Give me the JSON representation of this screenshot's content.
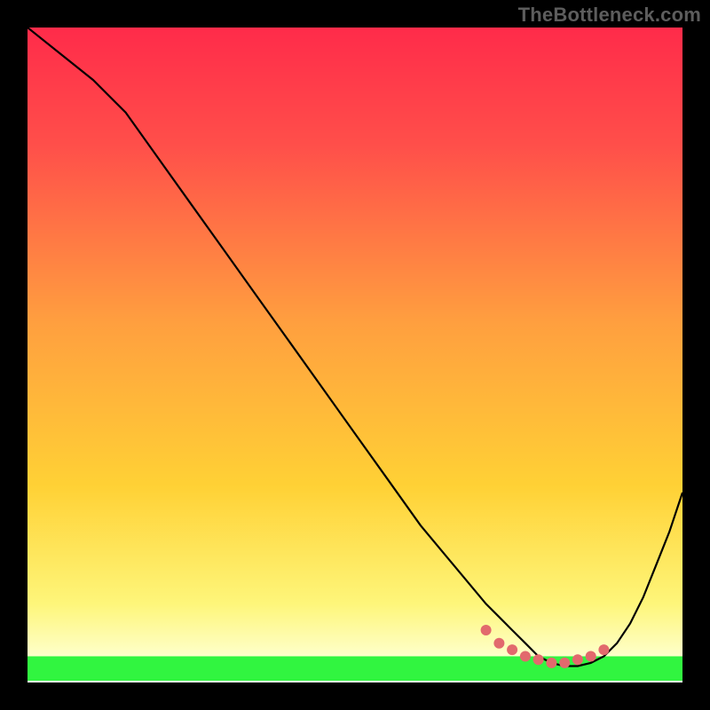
{
  "watermark": "TheBottleneck.com",
  "colors": {
    "curve": "#000000",
    "dots": "#e2696d",
    "green_band": "#31f540",
    "gradient_top": "#ff2b4a",
    "gradient_mid": "#ffd135",
    "gradient_low": "#fef67a",
    "gradient_bottom": "#ffffff"
  },
  "chart_data": {
    "type": "line",
    "title": "",
    "xlabel": "",
    "ylabel": "",
    "xlim": [
      0,
      100
    ],
    "ylim": [
      0,
      100
    ],
    "series": [
      {
        "name": "curve",
        "x": [
          0,
          5,
          10,
          15,
          20,
          25,
          30,
          35,
          40,
          45,
          50,
          55,
          60,
          65,
          70,
          72,
          74,
          76,
          78,
          80,
          82,
          84,
          86,
          88,
          90,
          92,
          94,
          96,
          98,
          100
        ],
        "y": [
          100,
          96,
          92,
          87,
          80,
          73,
          66,
          59,
          52,
          45,
          38,
          31,
          24,
          18,
          12,
          10,
          8,
          6,
          4,
          3,
          2.5,
          2.5,
          3,
          4,
          6,
          9,
          13,
          18,
          23,
          29
        ]
      }
    ],
    "markers": {
      "name": "bottleneck-range",
      "x": [
        70,
        72,
        74,
        76,
        78,
        80,
        82,
        84,
        86,
        88
      ],
      "y": [
        8,
        6,
        5,
        4,
        3.5,
        3,
        3,
        3.5,
        4,
        5
      ]
    },
    "bands": [
      {
        "name": "green",
        "y_from": 0,
        "y_to": 4
      }
    ]
  }
}
